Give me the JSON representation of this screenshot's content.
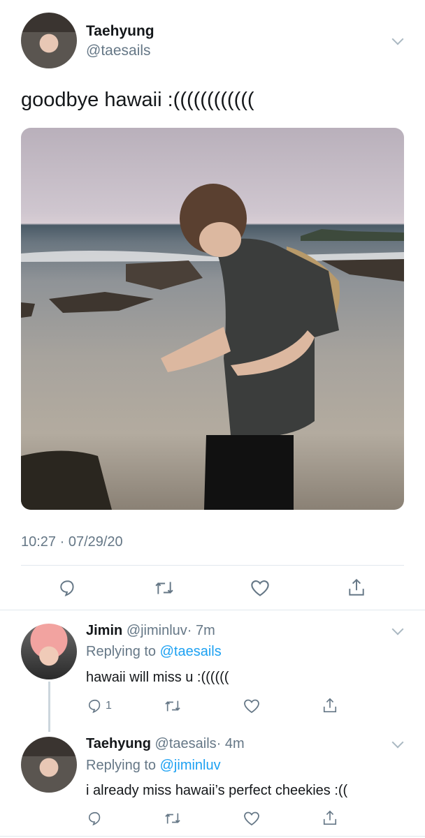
{
  "main_tweet": {
    "name": "Taehyung",
    "handle": "@taesails",
    "text": "goodbye hawaii :((((((((((((",
    "timestamp": "10:27 · 07/29/20"
  },
  "replies": [
    {
      "name": "Jimin",
      "handle": "@jiminluv",
      "time": "· 7m",
      "replying_label": "Replying to",
      "replying_to": "@taesails",
      "text": "hawaii will miss u :((((((",
      "reply_count": "1"
    },
    {
      "name": "Taehyung",
      "handle": "@taesails",
      "time": "· 4m",
      "replying_label": "Replying to",
      "replying_to": "@jiminluv",
      "text": "i already miss hawaii’s perfect cheekies :((",
      "reply_count": ""
    }
  ],
  "colors": {
    "link": "#1da1f2",
    "secondary": "#657786",
    "divider": "#e1e8ed"
  }
}
